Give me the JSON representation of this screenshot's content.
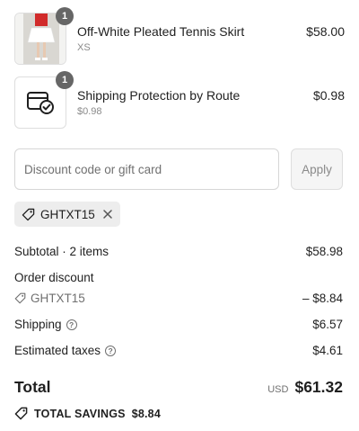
{
  "line_items": [
    {
      "title": "Off-White Pleated Tennis Skirt",
      "subtitle": "XS",
      "price": "$58.00",
      "quantity": "1"
    },
    {
      "title": "Shipping Protection by Route",
      "subtitle": "$0.98",
      "price": "$0.98",
      "quantity": "1"
    }
  ],
  "discount": {
    "placeholder": "Discount code or gift card",
    "apply_label": "Apply"
  },
  "applied_code": {
    "code": "GHTXT15"
  },
  "summary": {
    "subtotal_label": "Subtotal · 2 items",
    "subtotal_value": "$58.98",
    "order_discount_label": "Order discount",
    "discount_code": "GHTXT15",
    "discount_value": "– $8.84",
    "shipping_label": "Shipping",
    "shipping_value": "$6.57",
    "taxes_label": "Estimated taxes",
    "taxes_value": "$4.61",
    "total_label": "Total",
    "currency": "USD",
    "total_value": "$61.32",
    "savings_label": "TOTAL SAVINGS",
    "savings_value": "$8.84"
  },
  "icons": {
    "product_image": "tennis-skirt-photo",
    "route_logo": "package-check-icon",
    "tag": "tag-icon",
    "close": "close-icon",
    "help": "question-circle-icon"
  }
}
